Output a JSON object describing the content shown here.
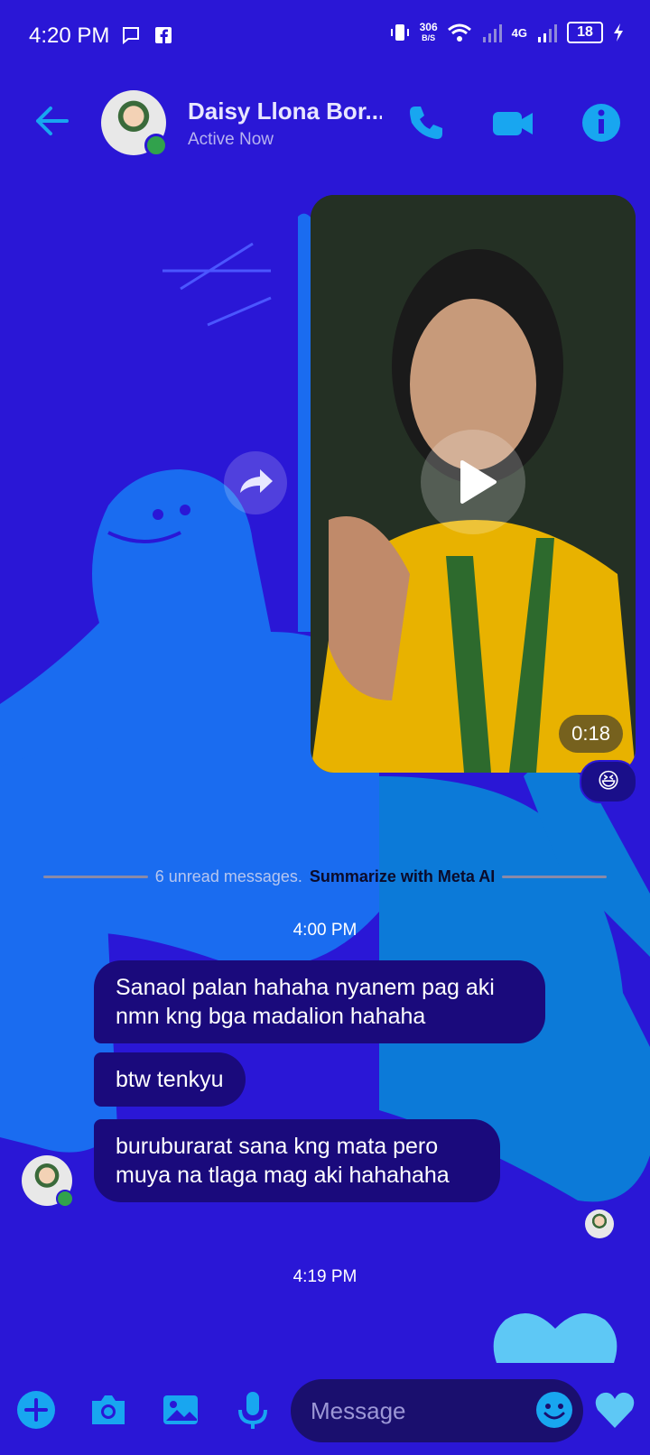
{
  "status_bar": {
    "time": "4:20 PM",
    "net_speed_value": "306",
    "net_speed_unit": "B/S",
    "network": "4G",
    "battery": "18"
  },
  "header": {
    "contact_name": "Daisy Llona Bor...",
    "contact_status": "Active Now",
    "icons": [
      "back-arrow-icon",
      "phone-icon",
      "video-camera-icon",
      "info-icon"
    ]
  },
  "video_message": {
    "duration": "0:18",
    "reaction": "😆"
  },
  "unread_divider": {
    "text": "6 unread messages.",
    "link": "Summarize with Meta AI"
  },
  "messages": {
    "timestamp_1": "4:00 PM",
    "bubble_1": "Sanaol palan hahaha nyanem pag aki nmn kng bga madalion hahaha",
    "bubble_2": "btw tenkyu",
    "bubble_3": "buruburarat sana kng mata pero muya na tlaga mag aki hahahaha",
    "timestamp_2": "4:19 PM"
  },
  "composer": {
    "placeholder": "Message",
    "icons": [
      "plus-icon",
      "camera-icon",
      "image-icon",
      "microphone-icon",
      "emoji-icon",
      "heart-icon"
    ]
  },
  "colors": {
    "background": "#2a17d6",
    "accent": "#0a9fe8",
    "bubble": "#1a0a7c",
    "online": "#31a24c"
  }
}
